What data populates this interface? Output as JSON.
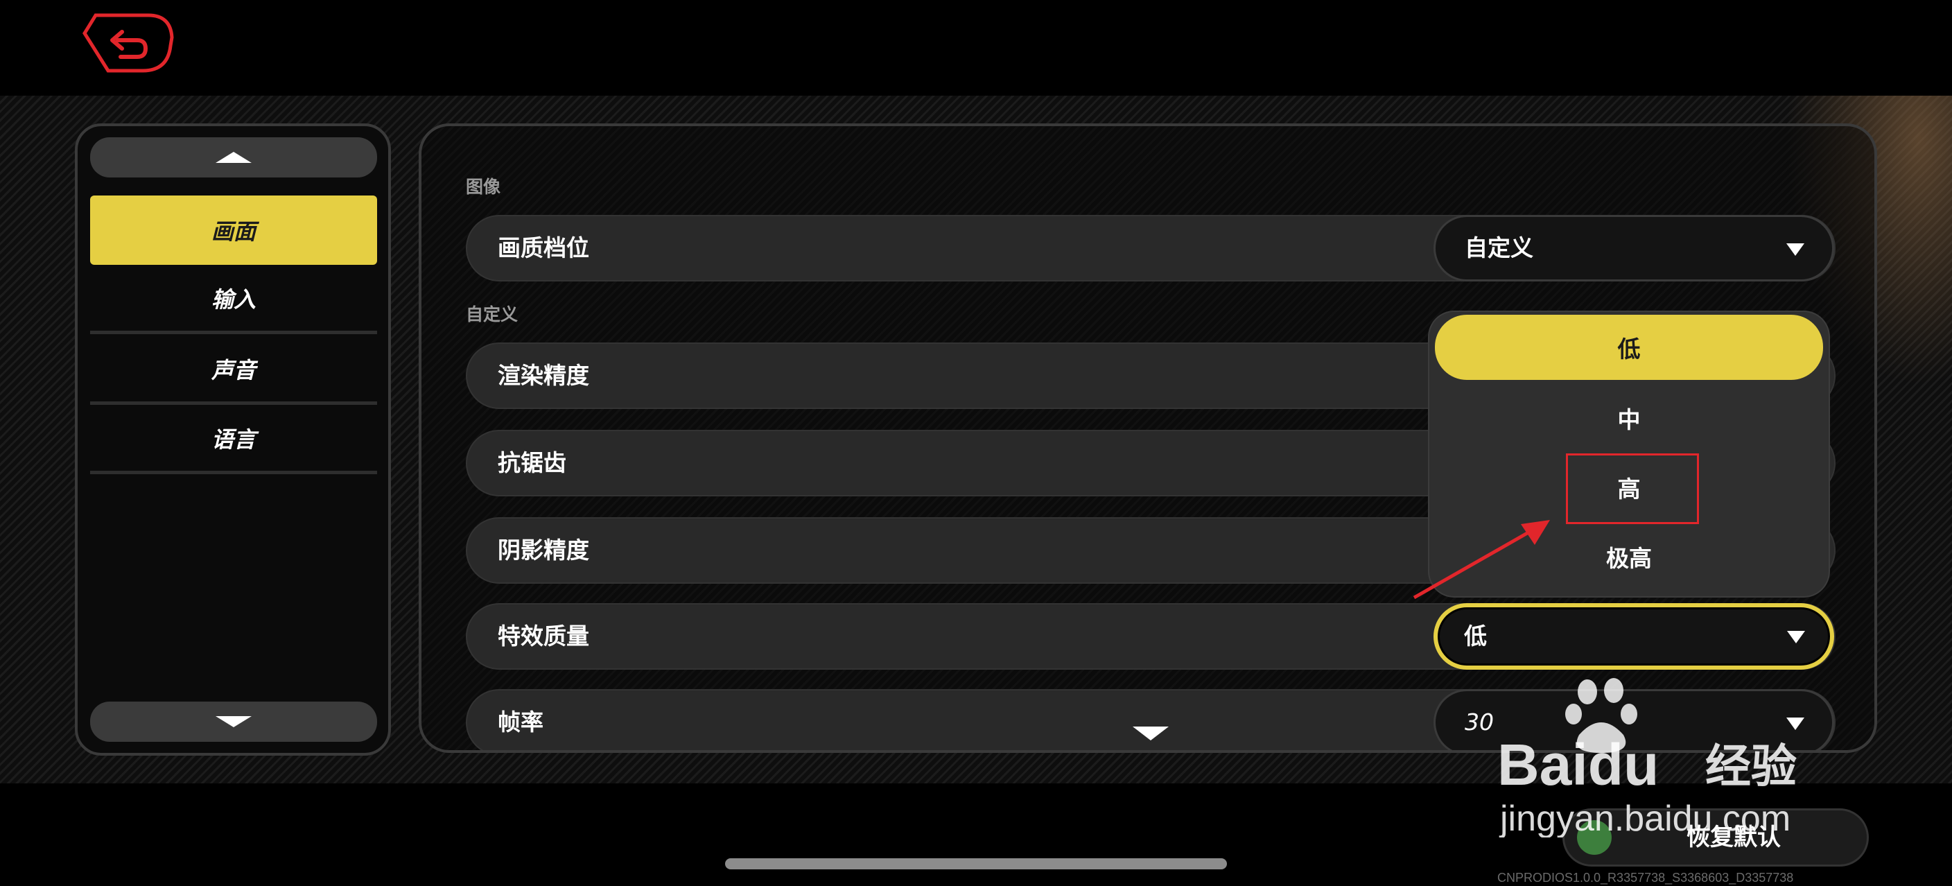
{
  "sidebar": {
    "items": [
      {
        "label": "画面",
        "active": true
      },
      {
        "label": "输入",
        "active": false
      },
      {
        "label": "声音",
        "active": false
      },
      {
        "label": "语言",
        "active": false
      }
    ]
  },
  "sections": {
    "image": "图像",
    "custom": "自定义"
  },
  "settings": {
    "quality_preset": {
      "label": "画质档位",
      "value": "自定义"
    },
    "render_precision": {
      "label": "渲染精度"
    },
    "anti_aliasing": {
      "label": "抗锯齿"
    },
    "shadow_precision": {
      "label": "阴影精度"
    },
    "effect_quality": {
      "label": "特效质量",
      "value": "低"
    },
    "frame_rate": {
      "label": "帧率",
      "value": "30"
    }
  },
  "dropdown": {
    "options": [
      "低",
      "中",
      "高",
      "极高"
    ],
    "selected": "低"
  },
  "footer": {
    "restore_label": "恢复默认",
    "build": "CNPRODIOS1.0.0_R3357738_S3368603_D3357738"
  },
  "watermark": {
    "brand": "Baidu",
    "suffix": "经验",
    "url": "jingyan.baidu.com"
  },
  "colors": {
    "accent": "#e5cf43",
    "back_icon": "#e2262b",
    "annotation": "#e2262b"
  }
}
